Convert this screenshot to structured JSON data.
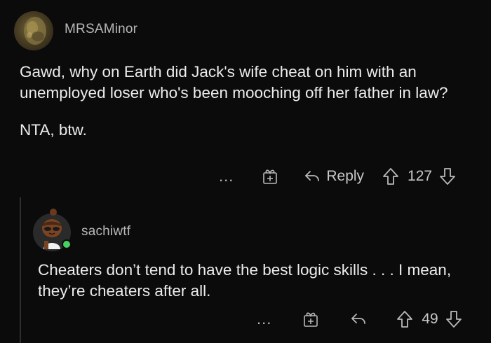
{
  "comments": [
    {
      "username": "MRSAMinor",
      "paragraphs": [
        "Gawd, why on Earth did Jack's wife cheat on him with an unemployed loser who's been mooching off her father in law?",
        "NTA, btw."
      ],
      "more_label": "...",
      "reply_label": "Reply",
      "score": "127"
    },
    {
      "username": "sachiwtf",
      "paragraphs": [
        "Cheaters don’t tend to have the best logic skills . . . I mean, they’re cheaters after all."
      ],
      "more_label": "...",
      "score": "49"
    }
  ],
  "icons": {
    "award": "award-icon",
    "reply": "reply-arrow-icon",
    "upvote": "upvote-arrow-icon",
    "downvote": "downvote-arrow-icon",
    "online": "online-status-dot"
  },
  "colors": {
    "background": "#0b0b0b",
    "text": "#ececec",
    "meta": "#b7b7b7",
    "online": "#46d160"
  }
}
